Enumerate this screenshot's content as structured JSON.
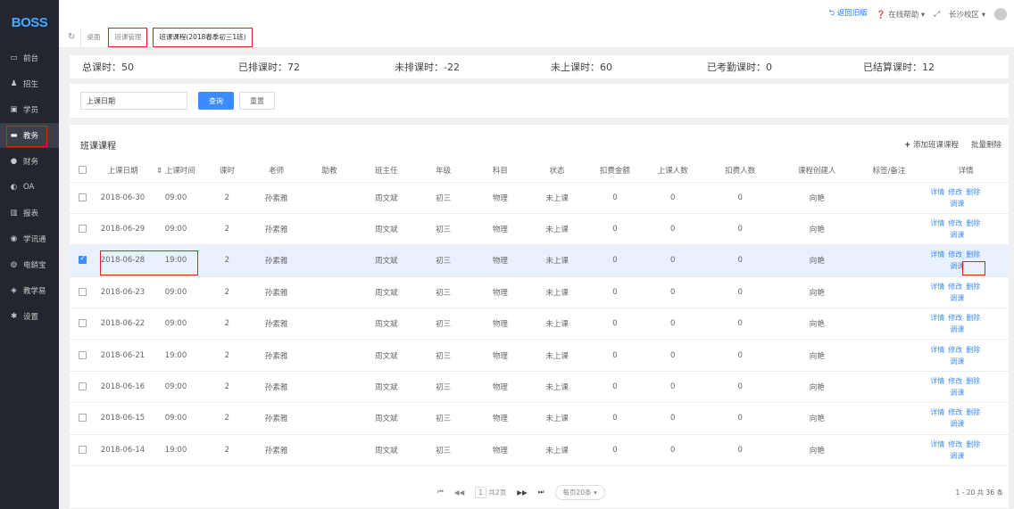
{
  "app": {
    "logo": "BOSS"
  },
  "sidebar": {
    "items": [
      {
        "label": "前台",
        "icon": "calendar-icon"
      },
      {
        "label": "招生",
        "icon": "users-icon"
      },
      {
        "label": "学员",
        "icon": "id-card-icon"
      },
      {
        "label": "教务",
        "icon": "book-icon"
      },
      {
        "label": "财务",
        "icon": "money-icon"
      },
      {
        "label": "OA",
        "icon": "oa-icon"
      },
      {
        "label": "报表",
        "icon": "bar-chart-icon"
      },
      {
        "label": "学讯通",
        "icon": "message-icon"
      },
      {
        "label": "电銷宝",
        "icon": "phone-icon"
      },
      {
        "label": "教学易",
        "icon": "teach-icon"
      },
      {
        "label": "设置",
        "icon": "gear-icon"
      }
    ]
  },
  "topbar": {
    "back": "返回旧版",
    "help": "在线帮助",
    "campus": "长沙校区"
  },
  "tabs": {
    "desktop": "桌面",
    "class_mgmt": "班课管理",
    "current": "班课课程(2018春季初三1班)"
  },
  "stats": {
    "total": "总课时：50",
    "scheduled": "已排课时：72",
    "unscheduled": "未排课时：-22",
    "not_attended": "未上课时：60",
    "checked": "已考勤课时：0",
    "settled": "已结算课时：12"
  },
  "filter": {
    "date_placeholder": "上课日期",
    "query": "查询",
    "reset": "重置"
  },
  "panel": {
    "title": "班课课程",
    "add": "添加班课课程",
    "batch_delete": "批量删除"
  },
  "columns": [
    "上课日期",
    "上课时间",
    "课时",
    "老师",
    "助教",
    "班主任",
    "年级",
    "科目",
    "状态",
    "扣费金额",
    "上课人数",
    "扣费人数",
    "课程创建人",
    "标签/备注",
    "详情"
  ],
  "ops": {
    "detail": "详情",
    "edit": "修改",
    "delete": "删除",
    "adjust": "调课"
  },
  "rows": [
    {
      "date": "2018-06-30",
      "time": "09:00",
      "hours": "2",
      "teacher": "孙素雅",
      "assistant": "",
      "head": "周文斌",
      "grade": "初三",
      "subject": "物理",
      "status": "未上课",
      "fee": "0",
      "attend": "0",
      "charged": "0",
      "creator": "向艳",
      "note": ""
    },
    {
      "date": "2018-06-29",
      "time": "09:00",
      "hours": "2",
      "teacher": "孙素雅",
      "assistant": "",
      "head": "周文斌",
      "grade": "初三",
      "subject": "物理",
      "status": "未上课",
      "fee": "0",
      "attend": "0",
      "charged": "0",
      "creator": "向艳",
      "note": ""
    },
    {
      "date": "2018-06-28",
      "time": "19:00",
      "hours": "2",
      "teacher": "孙素雅",
      "assistant": "",
      "head": "周文斌",
      "grade": "初三",
      "subject": "物理",
      "status": "未上课",
      "fee": "0",
      "attend": "0",
      "charged": "0",
      "creator": "向艳",
      "note": ""
    },
    {
      "date": "2018-06-23",
      "time": "09:00",
      "hours": "2",
      "teacher": "孙素雅",
      "assistant": "",
      "head": "周文斌",
      "grade": "初三",
      "subject": "物理",
      "status": "未上课",
      "fee": "0",
      "attend": "0",
      "charged": "0",
      "creator": "向艳",
      "note": ""
    },
    {
      "date": "2018-06-22",
      "time": "09:00",
      "hours": "2",
      "teacher": "孙素雅",
      "assistant": "",
      "head": "周文斌",
      "grade": "初三",
      "subject": "物理",
      "status": "未上课",
      "fee": "0",
      "attend": "0",
      "charged": "0",
      "creator": "向艳",
      "note": ""
    },
    {
      "date": "2018-06-21",
      "time": "19:00",
      "hours": "2",
      "teacher": "孙素雅",
      "assistant": "",
      "head": "周文斌",
      "grade": "初三",
      "subject": "物理",
      "status": "未上课",
      "fee": "0",
      "attend": "0",
      "charged": "0",
      "creator": "向艳",
      "note": ""
    },
    {
      "date": "2018-06-16",
      "time": "09:00",
      "hours": "2",
      "teacher": "孙素雅",
      "assistant": "",
      "head": "周文斌",
      "grade": "初三",
      "subject": "物理",
      "status": "未上课",
      "fee": "0",
      "attend": "0",
      "charged": "0",
      "creator": "向艳",
      "note": ""
    },
    {
      "date": "2018-06-15",
      "time": "09:00",
      "hours": "2",
      "teacher": "孙素雅",
      "assistant": "",
      "head": "周文斌",
      "grade": "初三",
      "subject": "物理",
      "status": "未上课",
      "fee": "0",
      "attend": "0",
      "charged": "0",
      "creator": "向艳",
      "note": ""
    },
    {
      "date": "2018-06-14",
      "time": "19:00",
      "hours": "2",
      "teacher": "孙素雅",
      "assistant": "",
      "head": "周文斌",
      "grade": "初三",
      "subject": "物理",
      "status": "未上课",
      "fee": "0",
      "attend": "0",
      "charged": "0",
      "creator": "向艳",
      "note": ""
    }
  ],
  "selected_row": 2,
  "pager": {
    "page": "1",
    "total_pages": "共2页",
    "per_page": "每页20条",
    "summary": "1 - 20  共 36 条"
  },
  "colors": {
    "accent": "#3b8cff",
    "highlight": "#e02020",
    "sidebar": "#23262e"
  }
}
